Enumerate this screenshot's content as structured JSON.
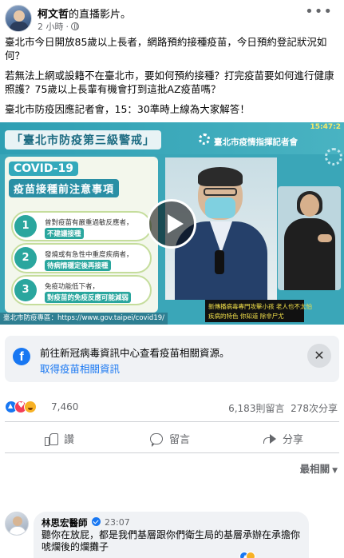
{
  "post": {
    "author": "柯文哲",
    "author_suffix": "的直播影片。",
    "time": "2 小時",
    "more": "•••",
    "paragraphs": [
      "臺北市今日開放85歲以上長者，網路預約接種疫苗，今日預約登記狀況如何？",
      "若無法上網或設籍不在臺北市，要如何預約接種？打完疫苗要如何進行健康照護？75歲以上長輩有機會打到這批AZ疫苗嗎？",
      "臺北市防疫因應記者會，15：30準時上線為大家解答！"
    ]
  },
  "video": {
    "timestamp": "15:47:2",
    "title": "「臺北市防疫第三級警戒」",
    "subtitle": "臺北市疫情指揮記者會",
    "covid_title": "COVID-19",
    "covid_subtitle": "疫苗接種前注意事項",
    "items": [
      {
        "num": "1",
        "line1": "曾對疫苗有嚴重過敏反應者，",
        "line2": "不建議接種"
      },
      {
        "num": "2",
        "line1": "發燒或有急性中重度疾病者，",
        "line2": "待病情穩定後再接種"
      },
      {
        "num": "3",
        "line1": "免疫功能低下者，",
        "line2": "對疫苗的免疫反應可能減弱"
      }
    ],
    "url": "臺北市防疫專區：https://www.gov.taipei/covid19/",
    "caption_line1": "新傳播病毒專門攻擊小孩 老人也不太怕",
    "caption_line2": "疾病的特色 你知道 除非尸尤"
  },
  "info_card": {
    "text": "前往新冠病毒資訊中心查看疫苗相關資源。",
    "link": "取得疫苗相關資訊",
    "fb_letter": "f",
    "close": "✕"
  },
  "reactions": {
    "count": "7,460",
    "comments": "6,183則留言",
    "shares": "278次分享"
  },
  "actions": {
    "like": "讚",
    "comment": "留言",
    "share": "分享"
  },
  "sort": {
    "label": "最相關",
    "chevron": "▼"
  },
  "comment": {
    "author": "林思宏醫師",
    "time": "23:07",
    "text": "聽你在放屁，都是我們基層跟你們衛生局的基層承辦在承擔你唬爛後的爛攤子"
  },
  "icons": {
    "globe": "globe-icon",
    "more": "more-icon",
    "play": "play-icon",
    "facebook": "facebook-icon",
    "close": "close-icon",
    "like": "like-icon",
    "comment": "comment-icon",
    "share": "share-icon",
    "verified": "verified-icon"
  },
  "colors": {
    "facebook_blue": "#1877f2",
    "text": "#050505",
    "secondary": "#65676b",
    "card_bg": "#f0f2f5",
    "video_teal": "#3aa6b8"
  }
}
